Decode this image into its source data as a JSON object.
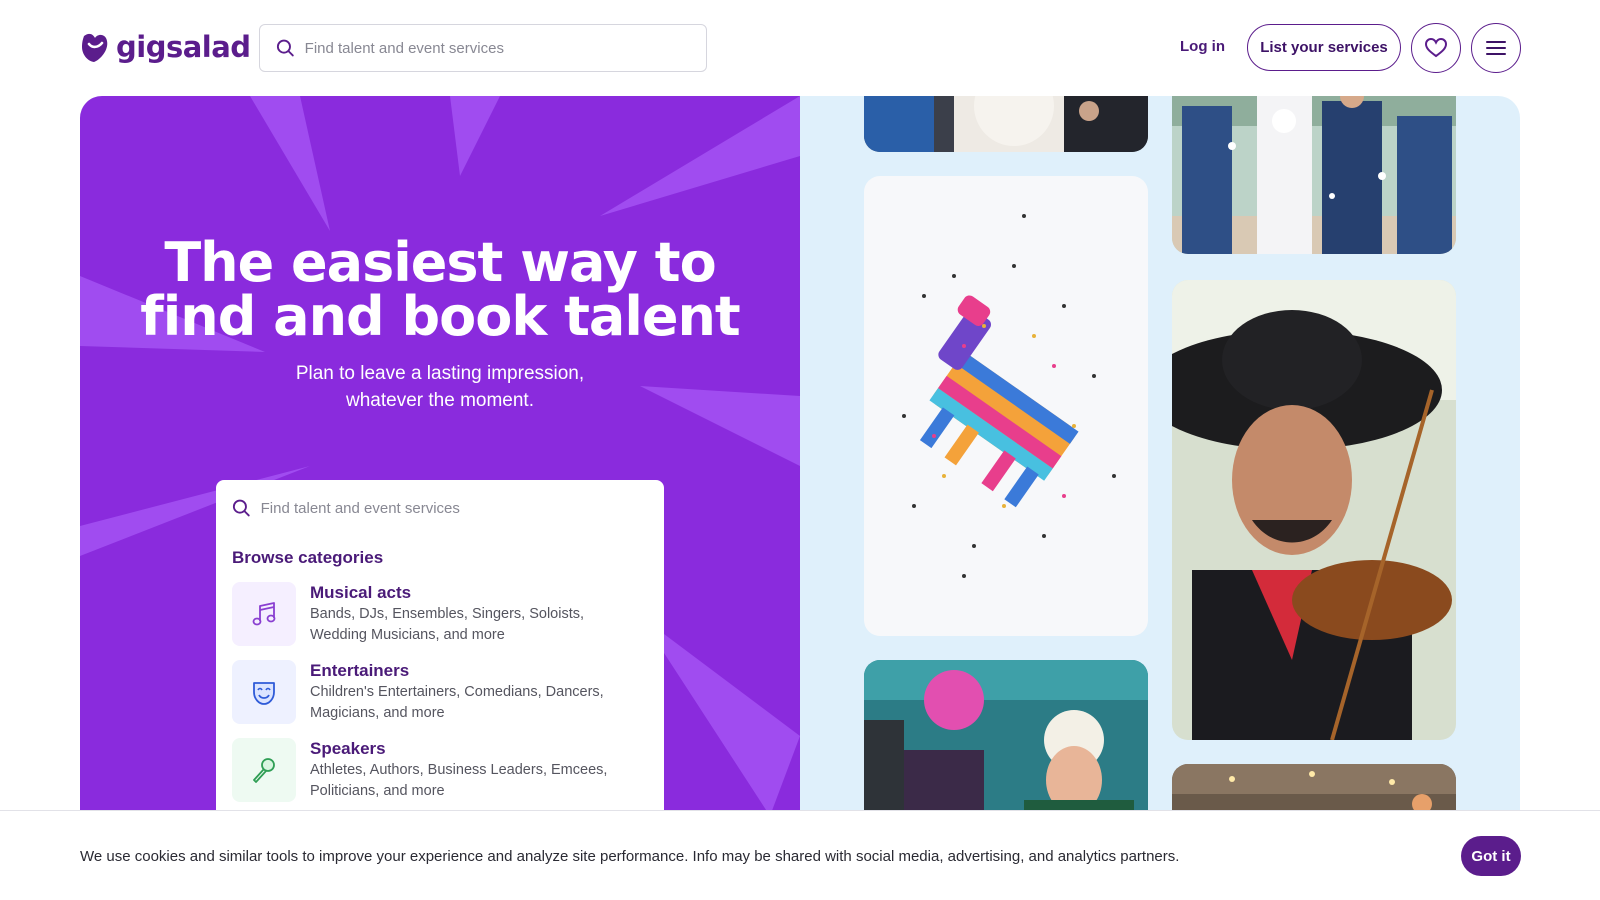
{
  "brand": {
    "name": "gigsalad",
    "color": "#5b1d8c"
  },
  "header": {
    "search_placeholder": "Find talent and event services",
    "login_label": "Log in",
    "list_services_label": "List your services",
    "favorites_icon": "heart-icon",
    "menu_icon": "hamburger-icon"
  },
  "hero": {
    "title_line1": "The easiest way to",
    "title_line2": "find and book talent",
    "subtitle_line1": "Plan to leave a lasting impression,",
    "subtitle_line2": "whatever the moment.",
    "bg_color": "#8a2bdd",
    "search_placeholder": "Find talent and event services",
    "browse_heading": "Browse categories",
    "categories": [
      {
        "title": "Musical acts",
        "desc": "Bands, DJs, Ensembles, Singers, Soloists, Wedding Musicians, and more",
        "icon": "music-note-icon"
      },
      {
        "title": "Entertainers",
        "desc": "Children's Entertainers, Comedians, Dancers, Magicians, and more",
        "icon": "theater-mask-icon"
      },
      {
        "title": "Speakers",
        "desc": "Athletes, Authors, Business Leaders, Emcees, Politicians, and more",
        "icon": "microphone-icon"
      }
    ]
  },
  "cookie": {
    "text": "We use cookies and similar tools to improve your experience and analyze site performance. Info may be shared with social media, advertising, and analytics partners.",
    "button_label": "Got it"
  }
}
